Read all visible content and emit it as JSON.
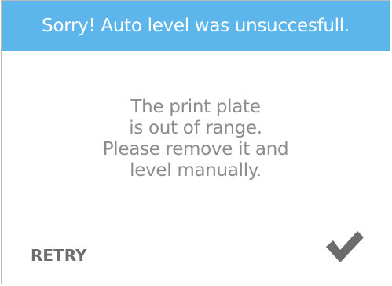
{
  "dialog": {
    "title": "Sorry! Auto level was unsuccesfull.",
    "message_lines": [
      "The print plate",
      "is out of range.",
      "Please remove it and",
      "level manually."
    ],
    "retry_label": "RETRY",
    "confirm_icon": "checkmark-icon"
  },
  "colors": {
    "header_bg": "#5cb6ec",
    "header_text": "#ffffff",
    "message_text": "#8c8c8c",
    "retry_text": "#6c6c6c",
    "checkmark": "#6c6c6c",
    "border": "#b9b9b9"
  }
}
